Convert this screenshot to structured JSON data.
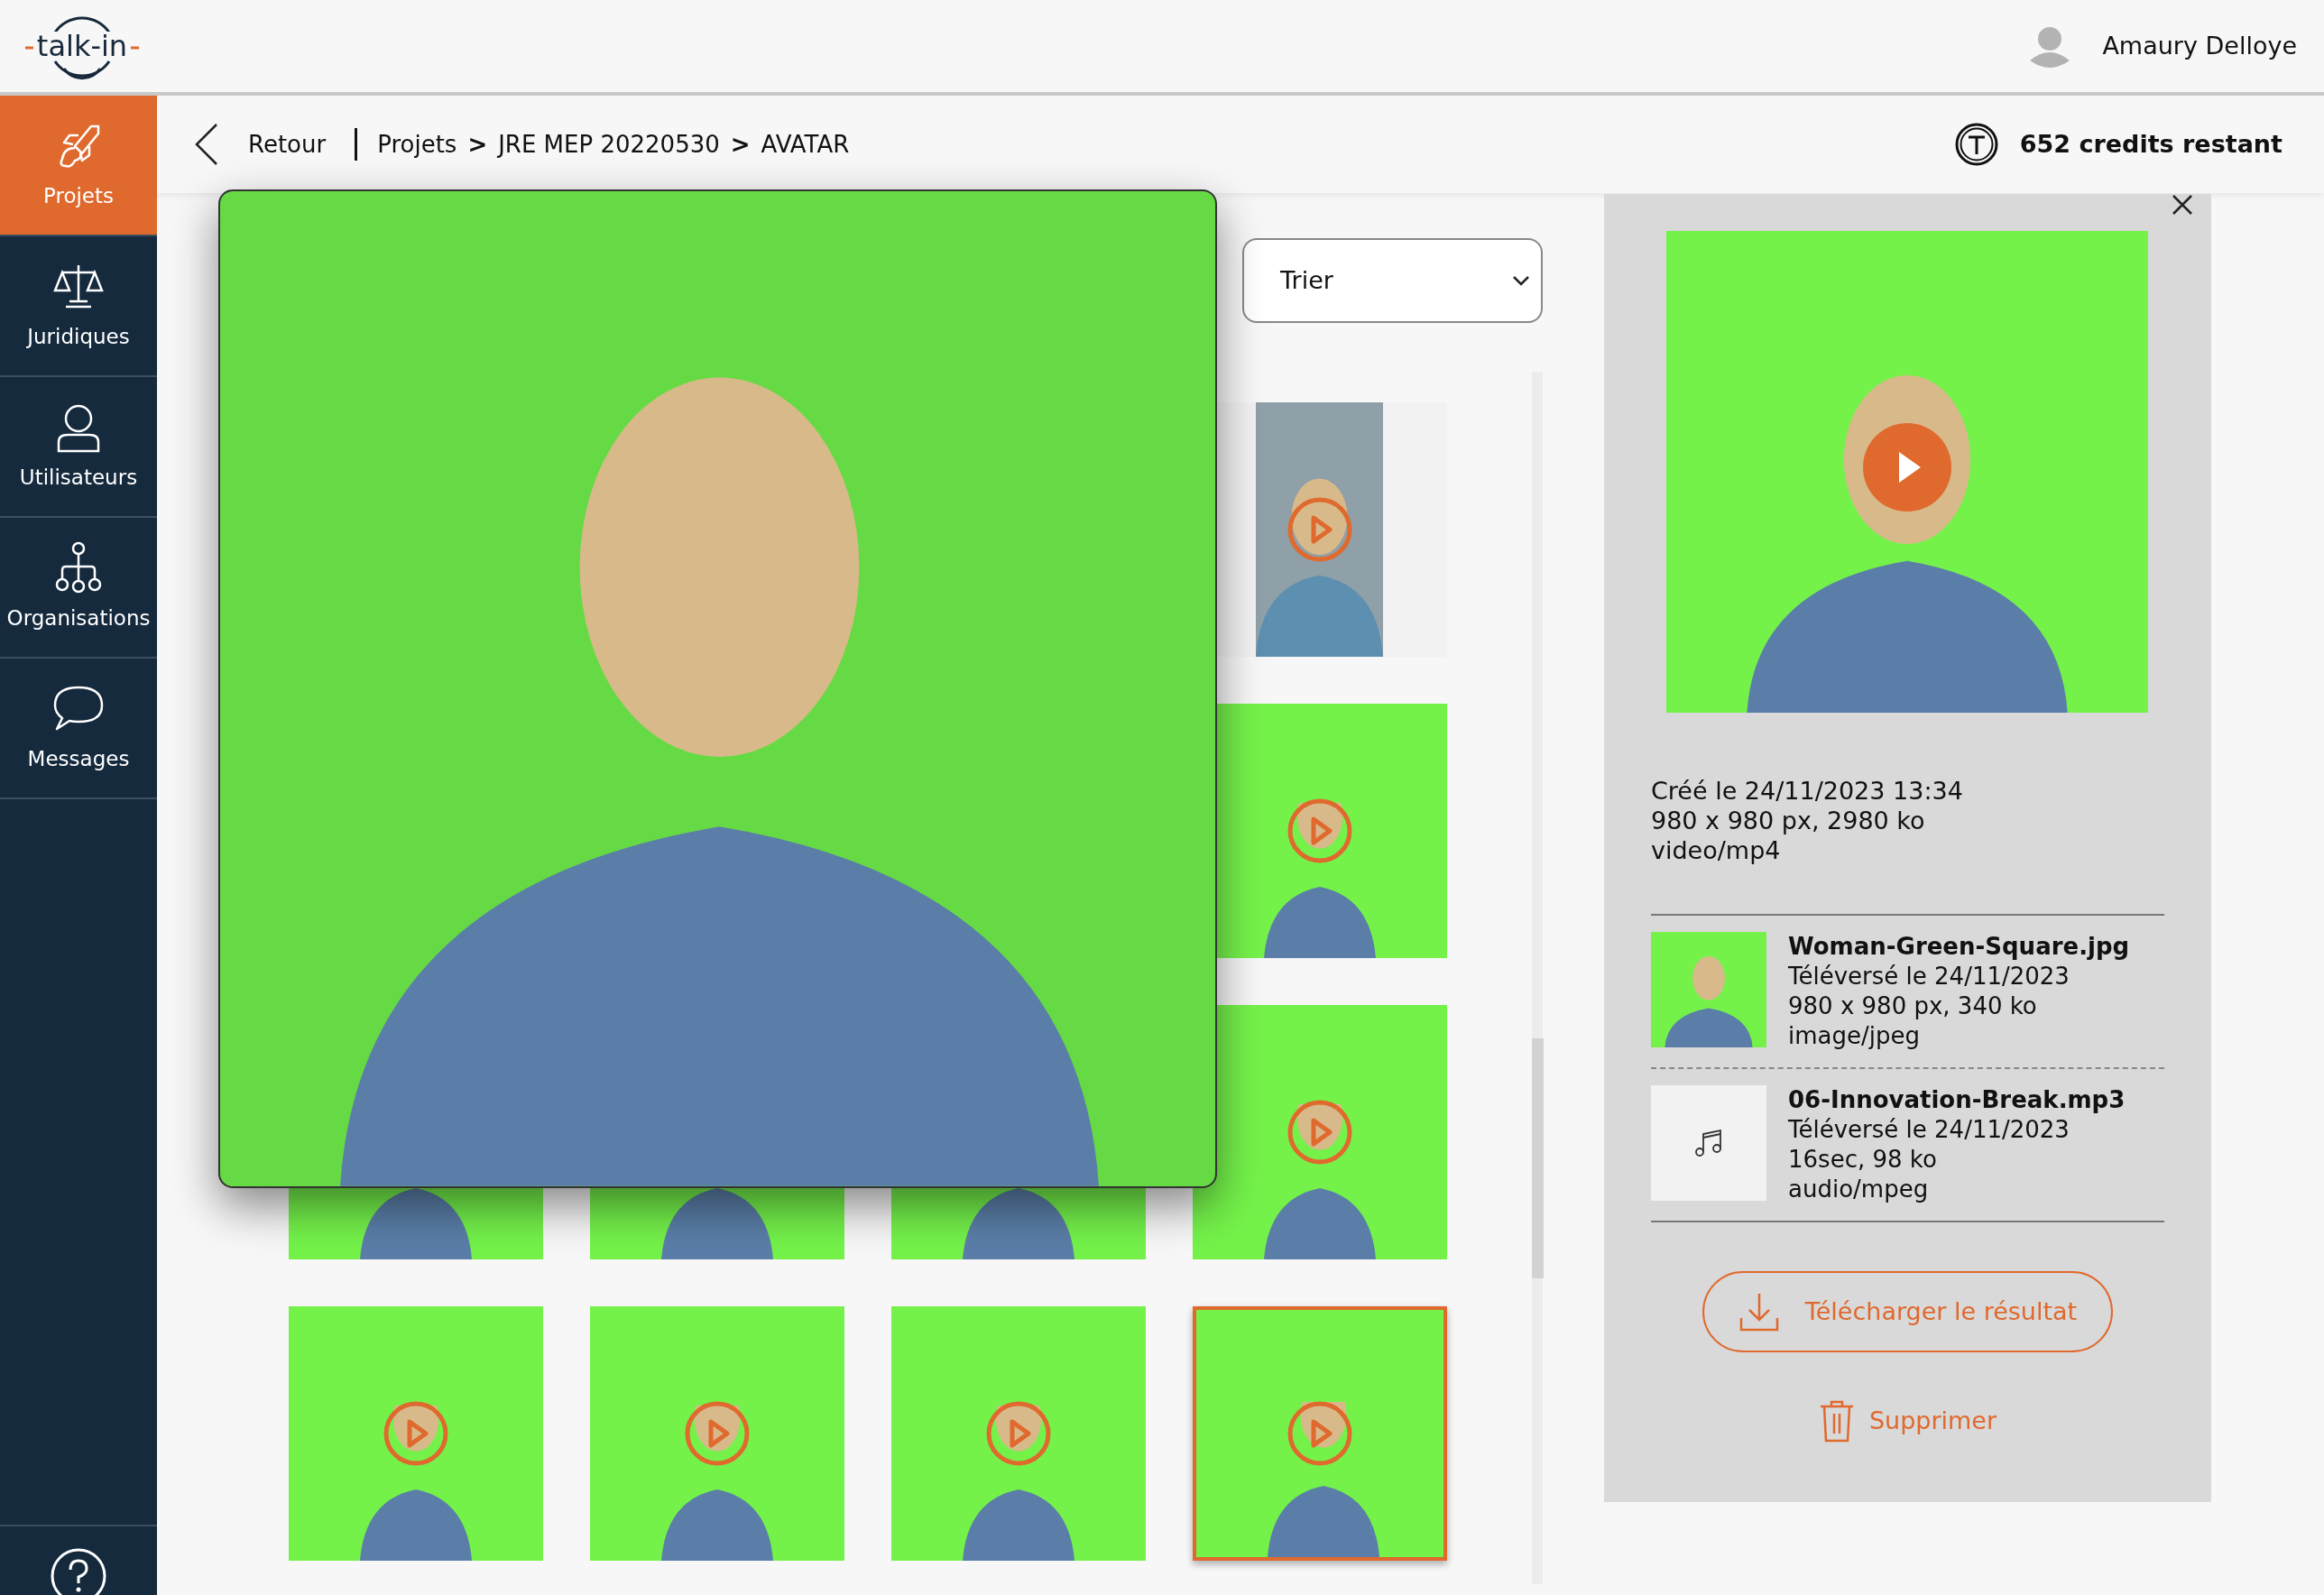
{
  "header": {
    "logo": "talk-in",
    "user_name": "Amaury Delloye"
  },
  "sidebar": {
    "items": [
      {
        "label": "Projets",
        "selected": true
      },
      {
        "label": "Juridiques",
        "selected": false
      },
      {
        "label": "Utilisateurs",
        "selected": false
      },
      {
        "label": "Organisations",
        "selected": false
      },
      {
        "label": "Messages",
        "selected": false
      }
    ]
  },
  "breadcrumb": {
    "back": "Retour",
    "separator": ">",
    "path": [
      "Projets",
      "JRE MEP 20220530",
      "AVATAR"
    ]
  },
  "credits": "652 credits restant",
  "sort": {
    "label": "Trier"
  },
  "thumbnail_rows": [
    [
      {
        "kind": "portrait",
        "selected": false
      }
    ],
    [
      {
        "kind": "square",
        "selected": false
      }
    ],
    [
      {
        "kind": "square",
        "selected": false
      },
      {
        "kind": "square",
        "selected": false
      },
      {
        "kind": "square",
        "selected": false
      },
      {
        "kind": "square",
        "selected": false
      }
    ],
    [
      {
        "kind": "square",
        "selected": false
      },
      {
        "kind": "square",
        "selected": false
      },
      {
        "kind": "square",
        "selected": false
      },
      {
        "kind": "square",
        "selected": true
      }
    ]
  ],
  "details": {
    "created": "Créé le 24/11/2023 13:34",
    "dimensions": "980 x 980 px, 2980 ko",
    "mime": "video/mp4",
    "sources": [
      {
        "kind": "image",
        "name": "Woman-Green-Square.jpg",
        "uploaded": "Téléversé le 24/11/2023",
        "info": "980 x 980 px, 340 ko",
        "mime": "image/jpeg"
      },
      {
        "kind": "audio",
        "name": "06-Innovation-Break.mp3",
        "uploaded": "Téléversé le 24/11/2023",
        "info": "16sec, 98 ko",
        "mime": "audio/mpeg"
      }
    ],
    "download_button": "Télécharger le résultat",
    "delete_button": "Supprimer"
  }
}
